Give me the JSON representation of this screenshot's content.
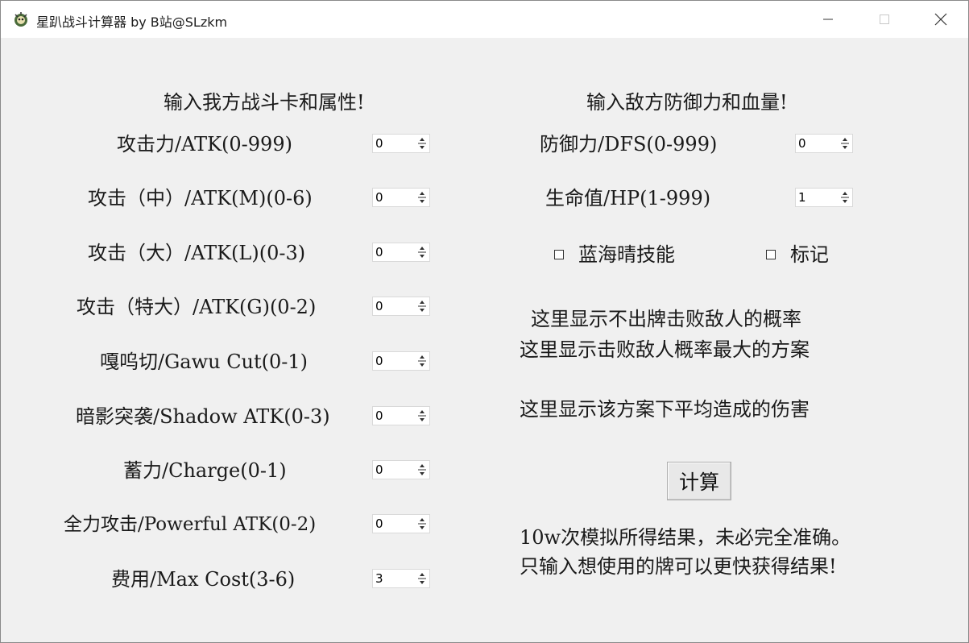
{
  "window": {
    "title": "星趴战斗计算器 by B站@SLzkm"
  },
  "left": {
    "heading": "输入我方战斗卡和属性!",
    "fields": [
      {
        "label": "攻击力/ATK(0-999)",
        "value": "0"
      },
      {
        "label": "攻击（中）/ATK(M)(0-6)",
        "value": "0"
      },
      {
        "label": "攻击（大）/ATK(L)(0-3)",
        "value": "0"
      },
      {
        "label": "攻击（特大）/ATK(G)(0-2)",
        "value": "0"
      },
      {
        "label": "嘎呜切/Gawu Cut(0-1)",
        "value": "0"
      },
      {
        "label": "暗影突袭/Shadow ATK(0-3)",
        "value": "0"
      },
      {
        "label": "蓄力/Charge(0-1)",
        "value": "0"
      },
      {
        "label": "全力攻击/Powerful ATK(0-2)",
        "value": "0"
      },
      {
        "label": "费用/Max Cost(3-6)",
        "value": "3"
      }
    ]
  },
  "right": {
    "heading": "输入敌方防御力和血量!",
    "defense": {
      "label": "防御力/DFS(0-999)",
      "value": "0"
    },
    "hp": {
      "label": "生命值/HP(1-999)",
      "value": "1"
    },
    "checkbox_skill": "蓝海晴技能",
    "checkbox_mark": "标记",
    "result_line1": "这里显示不出牌击败敌人的概率",
    "result_line2": "这里显示击败敌人概率最大的方案",
    "result_line3": "这里显示该方案下平均造成的伤害",
    "calc_button": "计算",
    "note_line1": "10w次模拟所得结果，未必完全准确。",
    "note_line2": "只输入想使用的牌可以更快获得结果!"
  }
}
